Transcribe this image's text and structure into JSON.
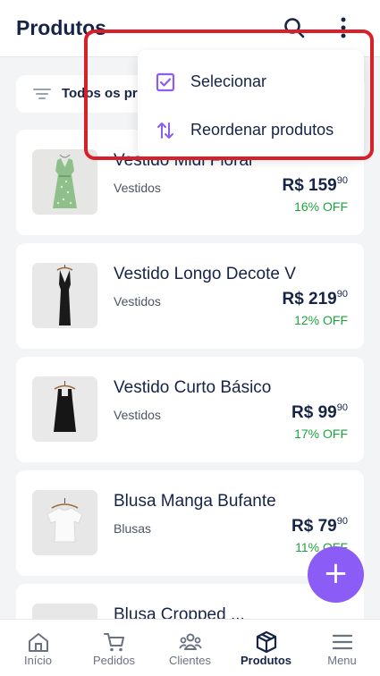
{
  "header": {
    "title": "Produtos"
  },
  "filter": {
    "label": "Todos os pro"
  },
  "menu": {
    "items": [
      {
        "label": "Selecionar",
        "icon": "checkbox-checked-icon"
      },
      {
        "label": "Reordenar produtos",
        "icon": "sort-arrows-icon"
      }
    ]
  },
  "products": [
    {
      "name": "Vestido Midi Floral",
      "category": "Vestidos",
      "price_main": "R$ 159",
      "price_cents": "90",
      "discount": "16% OFF"
    },
    {
      "name": "Vestido Longo Decote V",
      "category": "Vestidos",
      "price_main": "R$ 219",
      "price_cents": "90",
      "discount": "12% OFF"
    },
    {
      "name": "Vestido Curto Básico",
      "category": "Vestidos",
      "price_main": "R$ 99",
      "price_cents": "90",
      "discount": "17% OFF"
    },
    {
      "name": "Blusa Manga Bufante",
      "category": "Blusas",
      "price_main": "R$ 79",
      "price_cents": "90",
      "discount": "11% OFF"
    },
    {
      "name": "Blusa Cropped ...",
      "category": "",
      "price_main": "",
      "price_cents": "",
      "discount": ""
    }
  ],
  "fab": {
    "label": "+"
  },
  "nav": [
    {
      "label": "Início",
      "icon": "home-icon"
    },
    {
      "label": "Pedidos",
      "icon": "cart-icon"
    },
    {
      "label": "Clientes",
      "icon": "clients-icon"
    },
    {
      "label": "Produtos",
      "icon": "box-icon",
      "active": true
    },
    {
      "label": "Menu",
      "icon": "hamburger-icon"
    }
  ],
  "colors": {
    "accent": "#8b5cf6",
    "discount": "#1fa33c",
    "highlight": "#d81f2a",
    "text": "#162447"
  }
}
